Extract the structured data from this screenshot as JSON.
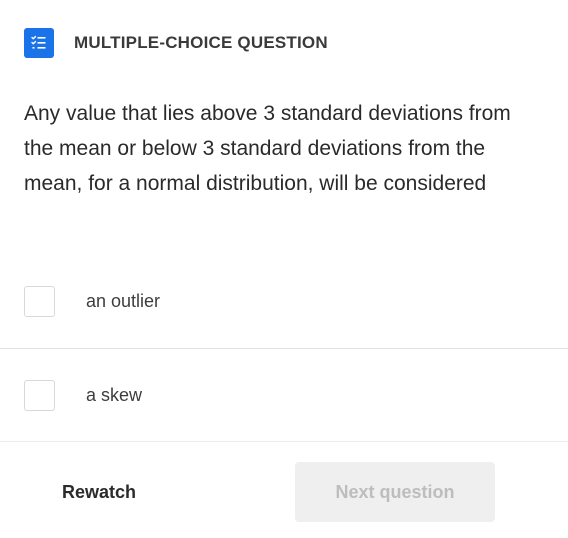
{
  "header": {
    "icon": "checklist-icon",
    "title": "MULTIPLE-CHOICE QUESTION",
    "icon_color": "#1a73e8"
  },
  "question": {
    "text": "Any value that lies above 3 standard deviations from the mean or below 3 standard deviations from the mean, for a normal distribution, will be considered"
  },
  "options": [
    {
      "label": "an outlier",
      "checked": false
    },
    {
      "label": "a skew",
      "checked": false
    }
  ],
  "footer": {
    "rewatch_label": "Rewatch",
    "next_label": "Next question",
    "next_enabled": false
  }
}
